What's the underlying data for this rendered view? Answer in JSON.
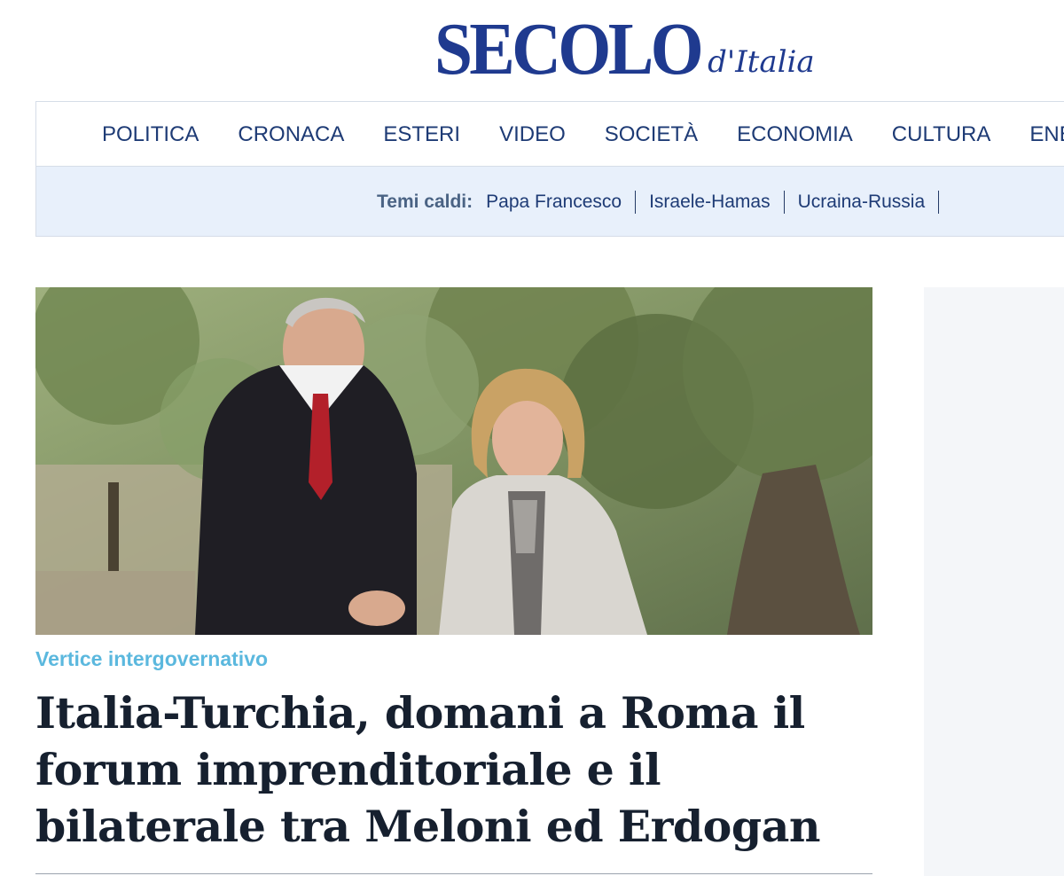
{
  "logo": {
    "main": "SECOLO",
    "sub": "d'Italia"
  },
  "nav": {
    "items": [
      "POLITICA",
      "CRONACA",
      "ESTERI",
      "VIDEO",
      "SOCIETÀ",
      "ECONOMIA",
      "CULTURA",
      "ENERGIA"
    ]
  },
  "hot_topics": {
    "label": "Temi caldi:",
    "items": [
      "Papa Francesco",
      "Israele-Hamas",
      "Ucraina-Russia"
    ]
  },
  "article": {
    "kicker": "Vertice intergovernativo",
    "headline": "Italia-Turchia, domani a Roma il forum imprenditoriale e il bilaterale tra Meloni ed Erdogan"
  },
  "colors": {
    "brand": "#1f3a8f",
    "nav_text": "#1e3b75",
    "hot_bar_bg": "#e8f0fb",
    "kicker": "#5bb8de",
    "headline": "#16202f"
  }
}
